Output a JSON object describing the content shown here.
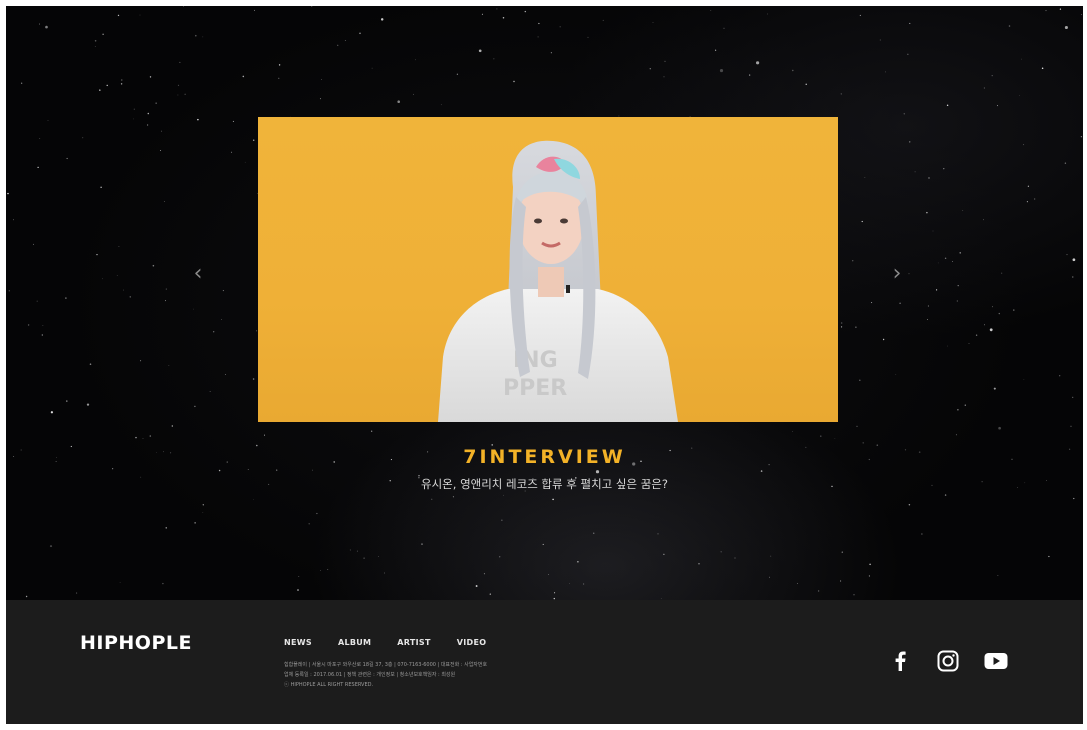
{
  "hero": {
    "prev_arrow": "‹",
    "next_arrow": "›",
    "video_title": "7INTERVIEW",
    "video_subtitle": "유시온, 영앤리치 레코즈 합류 후 펼치고 싶은 꿈은?",
    "colors": {
      "accent": "#f3b227",
      "video_background": "#efb037",
      "page_background": "#050506"
    }
  },
  "footer": {
    "logo": "HIPHOPLE",
    "menu": [
      "NEWS",
      "ALBUM",
      "ARTIST",
      "VIDEO"
    ],
    "info_lines": [
      "힙합플레이 | 서울시 마포구 와우산로 18길 37, 3층 | 070-7163-6000 | 대표전화 : 사업자번호",
      "업체 등록일 : 2017.06.01 | 정책 관련은 : 개인정보 | 청소년보호책임자 : 최성원",
      "ⓒ HIPHOPLE ALL RIGHT RESERVED."
    ],
    "social": [
      {
        "icon": "facebook-icon"
      },
      {
        "icon": "instagram-icon"
      },
      {
        "icon": "youtube-icon"
      }
    ],
    "colors": {
      "background": "#1c1c1c",
      "text": "#ffffff"
    }
  }
}
